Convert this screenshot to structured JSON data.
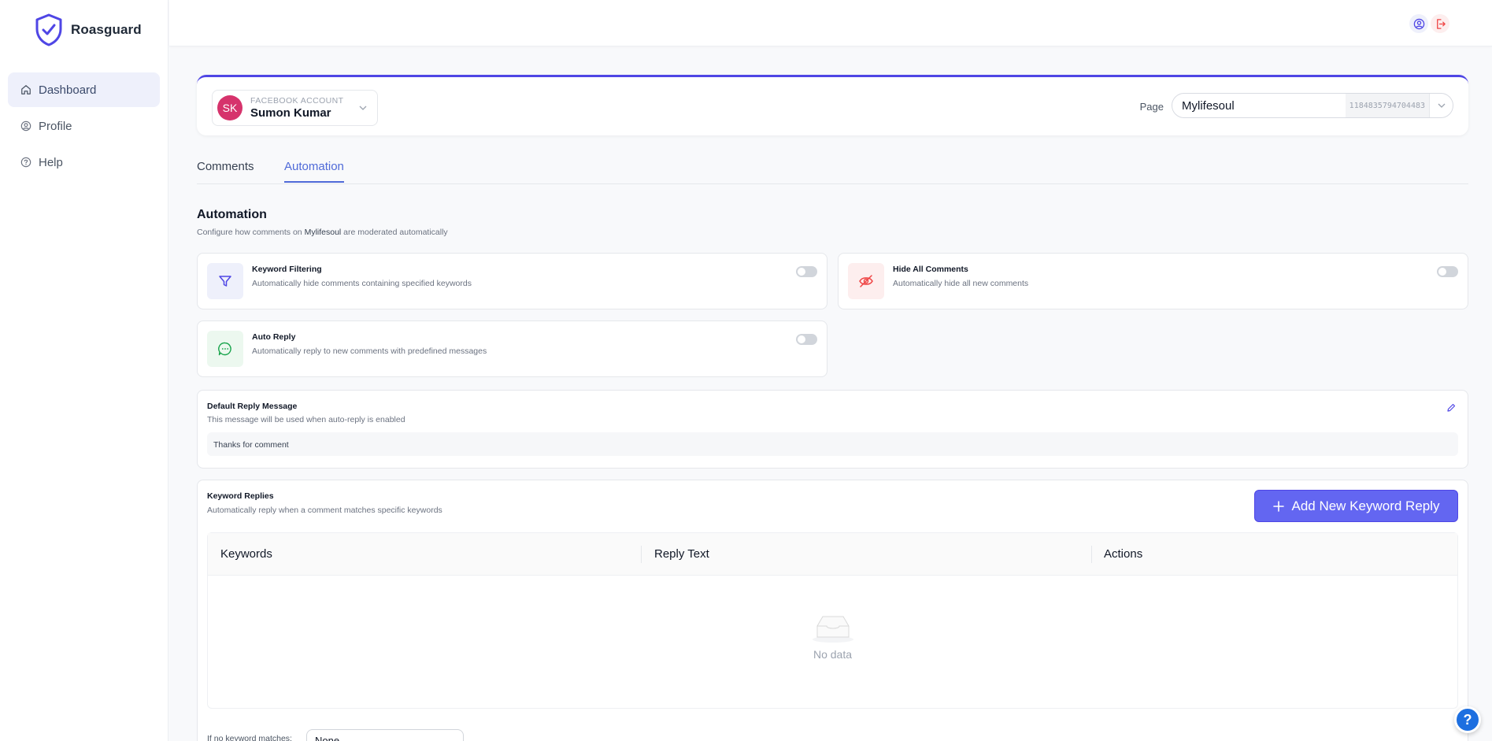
{
  "app": {
    "name": "Roasguard"
  },
  "sidebar": {
    "items": [
      {
        "label": "Dashboard",
        "icon": "home-icon",
        "active": true
      },
      {
        "label": "Profile",
        "icon": "user-circle-icon"
      },
      {
        "label": "Help",
        "icon": "help-circle-icon"
      }
    ]
  },
  "account": {
    "label": "FACEBOOK ACCOUNT",
    "initials": "SK",
    "name": "Sumon Kumar",
    "avatar_color": "#d6336c"
  },
  "page": {
    "label": "Page",
    "name": "Mylifesoul",
    "id": "1184835794704483"
  },
  "tabs": [
    {
      "label": "Comments"
    },
    {
      "label": "Automation",
      "active": true
    }
  ],
  "automation": {
    "title": "Automation",
    "subtitle_prefix": "Configure how comments on ",
    "subtitle_page": "Mylifesoul",
    "subtitle_suffix": " are moderated automatically",
    "cards": [
      {
        "title": "Keyword Filtering",
        "desc": "Automatically hide comments containing specified keywords",
        "icon": "filter-icon",
        "enabled": false
      },
      {
        "title": "Hide All Comments",
        "desc": "Automatically hide all new comments",
        "icon": "eye-off-icon",
        "enabled": false
      },
      {
        "title": "Auto Reply",
        "desc": "Automatically reply to new comments with predefined messages",
        "icon": "message-icon",
        "enabled": false
      }
    ]
  },
  "default_reply": {
    "title": "Default Reply Message",
    "desc": "This message will be used when auto-reply is enabled",
    "message": "Thanks for comment"
  },
  "keyword_replies": {
    "title": "Keyword Replies",
    "desc": "Automatically reply when a comment matches specific keywords",
    "add_label": "Add New Keyword Reply",
    "columns": [
      "Keywords",
      "Reply Text",
      "Actions"
    ],
    "empty_text": "No data",
    "fallback_label": "If no keyword matches:",
    "fallback_value": "None"
  },
  "colors": {
    "accent": "#6366f1",
    "brand": "#4f46e5",
    "danger": "#ef4444",
    "success": "#16a34a"
  }
}
